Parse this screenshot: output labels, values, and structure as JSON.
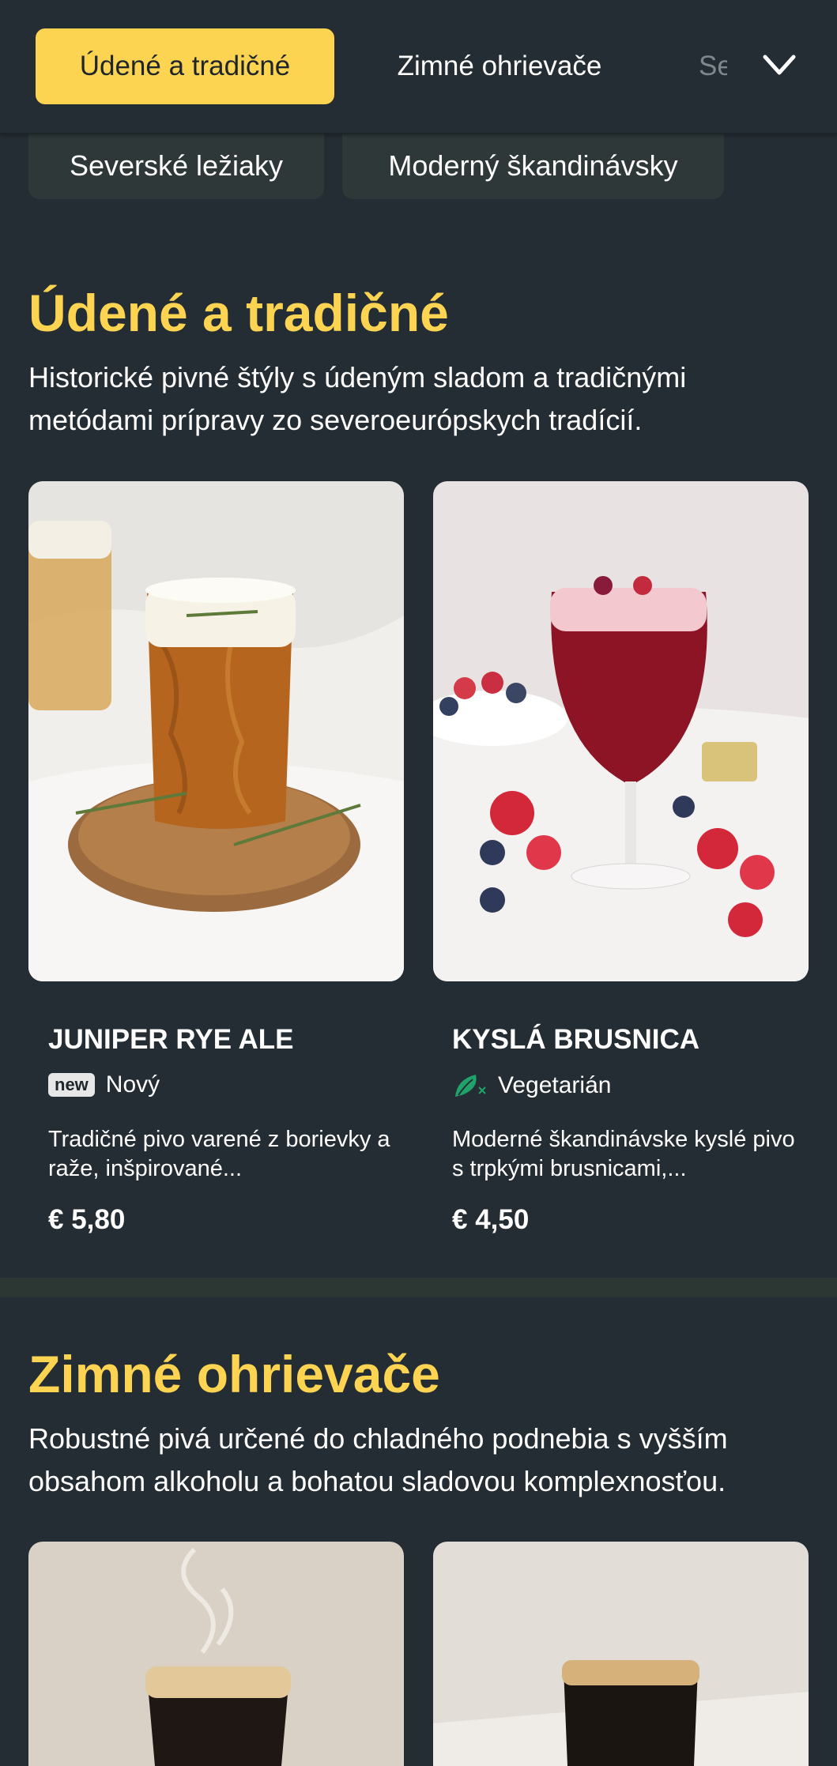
{
  "tabs": [
    {
      "label": "Údené a tradičné",
      "active": true
    },
    {
      "label": "Zimné ohrievače",
      "active": false
    },
    {
      "label": "Severské ležiaky",
      "active": false
    }
  ],
  "subcategories": [
    "Severské ležiaky",
    "Moderný škandinávsky"
  ],
  "sections": [
    {
      "title": "Údené a tradičné",
      "description": "Historické pivné štýly s údeným sladom a tradičnými metódami prípravy zo severoeurópskych tradícií.",
      "items": [
        {
          "name": "JUNIPER RYE ALE",
          "badge_icon": "new",
          "badge_label": "Nový",
          "description": "Tradičné pivo varené z borievky a raže, inšpirované...",
          "price": "€ 5,80"
        },
        {
          "name": "KYSLÁ BRUSNICA",
          "badge_icon": "vegetarian-leaf-icon",
          "badge_label": "Vegetarián",
          "description": "Moderné škandinávske kyslé pivo s trpkými brusnicami,...",
          "price": "€ 4,50"
        }
      ]
    },
    {
      "title": "Zimné ohrievače",
      "description": "Robustné pivá určené do chladného podnebia s vyšším obsahom alkoholu a bohatou sladovou komplexnosťou."
    }
  ],
  "colors": {
    "background": "#242d33",
    "accent": "#fcd452",
    "chip": "#2e3838",
    "vegetarian": "#1fa36a"
  }
}
